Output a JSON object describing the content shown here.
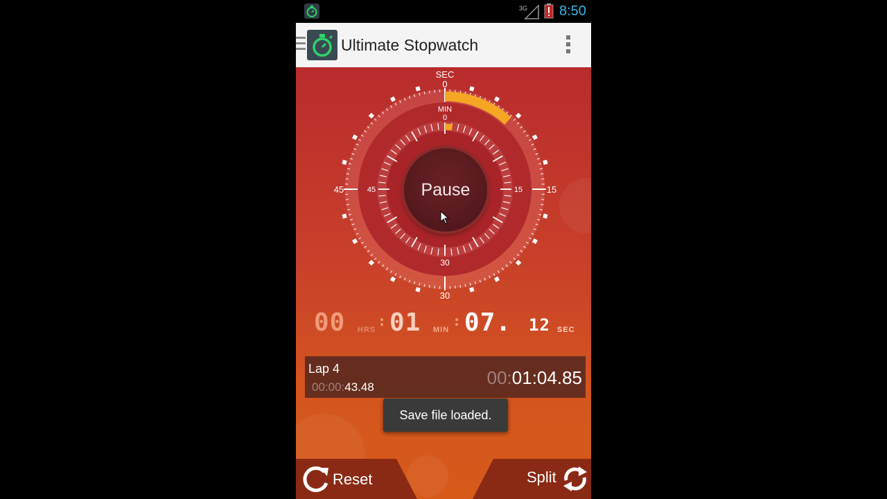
{
  "status_bar": {
    "time": "8:50",
    "network": "3G",
    "app_icon": "stopwatch-icon"
  },
  "action_bar": {
    "title": "Ultimate Stopwatch",
    "logo_icon": "stopwatch-icon",
    "overflow_icon": "overflow-menu-icon"
  },
  "dial": {
    "sec_label": "SEC",
    "min_label": "MIN",
    "outer_top": "0",
    "outer_right": "15",
    "outer_bottom": "30",
    "outer_left": "45",
    "inner_top": "0",
    "inner_right": "15",
    "inner_bottom": "30",
    "inner_left": "45",
    "seconds_progress": 7.12,
    "minutes_progress": 1.12,
    "pause_label": "Pause"
  },
  "timer": {
    "hours": "00",
    "hours_unit": "HRS",
    "minutes": "01",
    "minutes_unit": "MIN",
    "seconds": "07.",
    "hundredths": "12",
    "seconds_unit": "SEC"
  },
  "lap": {
    "title": "Lap 4",
    "split_dim": "00:00:",
    "split_bright": "43.48",
    "total_dim": "00:",
    "total_bright": "01:04.85"
  },
  "toast": {
    "message": "Save file loaded."
  },
  "buttons": {
    "reset_label": "Reset",
    "split_label": "Split"
  },
  "colors": {
    "accent_orange": "#f5a623",
    "status_time": "#33b5e5",
    "app_green": "#2ed36a"
  }
}
